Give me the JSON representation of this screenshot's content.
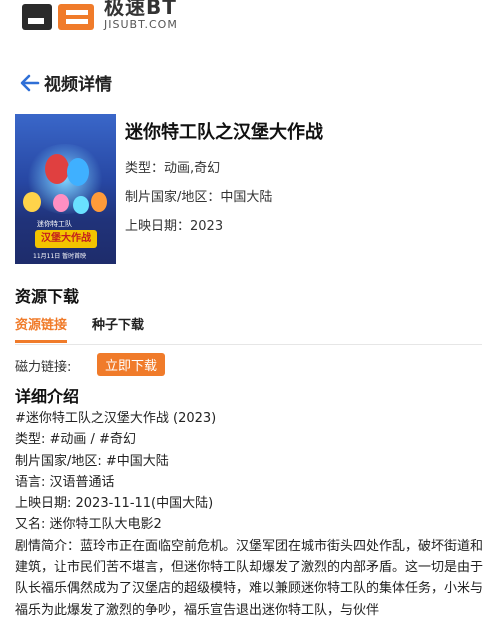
{
  "logo": {
    "cn": "极速BT",
    "en": "JISUBT.COM"
  },
  "header": {
    "title": "视频详情"
  },
  "movie": {
    "title": "迷你特工队之汉堡大作战",
    "type_label": "类型：",
    "type_value": "动画,奇幻",
    "region_label": "制片国家/地区：",
    "region_value": "中国大陆",
    "date_label": "上映日期：",
    "date_value": "2023",
    "poster": {
      "banner": "汉堡大作战",
      "sub": "迷你特工队",
      "date": "11月11日  暂时首映"
    }
  },
  "resources": {
    "title": "资源下载",
    "tabs": [
      {
        "label": "资源链接",
        "active": true
      },
      {
        "label": "种子下载",
        "active": false
      }
    ],
    "magnet_label": "磁力链接:",
    "download_label": "立即下载"
  },
  "details": {
    "title": "详细介绍",
    "lines": [
      "#迷你特工队之汉堡大作战 (2023)",
      "类型: #动画 / #奇幻",
      "制片国家/地区: #中国大陆",
      "语言: 汉语普通话",
      "上映日期: 2023-11-11(中国大陆)",
      "又名: 迷你特工队大电影2"
    ],
    "synopsis": "剧情简介：蓝玲市正在面临空前危机。汉堡军团在城市街头四处作乱，破坏街道和建筑，让市民们苦不堪言，但迷你特工队却爆发了激烈的内部矛盾。这一切是由于队长福乐偶然成为了汉堡店的超级模特，难以兼顾迷你特工队的集体任务，小米与福乐为此爆发了激烈的争吵，福乐宣告退出迷你特工队，与伙伴"
  },
  "colors": {
    "accent": "#f07b2a",
    "back_arrow": "#2f6fd6"
  }
}
